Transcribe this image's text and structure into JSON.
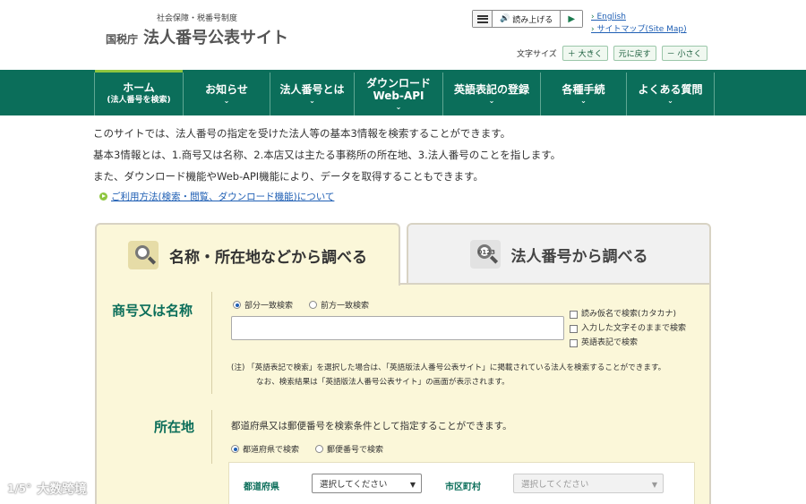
{
  "header": {
    "logo_sub": "社会保障・税番号制度",
    "logo_agency": "国税庁",
    "logo_title": "法人番号公表サイト",
    "read_aloud_label": "読み上げる",
    "play_symbol": "▶",
    "link_english": "English",
    "link_sitemap": "サイトマップ(Site Map)",
    "fontsize_label": "文字サイズ",
    "font_larger": "＋ 大きく",
    "font_reset": "元に戻す",
    "font_smaller": "－ 小さく"
  },
  "nav": {
    "items": [
      {
        "label": "ホーム",
        "sub": "(法人番号を検索)"
      },
      {
        "label": "お知らせ"
      },
      {
        "label": "法人番号とは"
      },
      {
        "label": "ダウンロード",
        "sub": "Web-API"
      },
      {
        "label": "英語表記の登録"
      },
      {
        "label": "各種手続"
      },
      {
        "label": "よくある質問"
      }
    ],
    "chev": "⌄"
  },
  "intro": {
    "line1": "このサイトでは、法人番号の指定を受けた法人等の基本3情報を検索することができます。",
    "line2": "基本3情報とは、1.商号又は名称、2.本店又は主たる事務所の所在地、3.法人番号のことを指します。",
    "line3": "また、ダウンロード機能やWeb-API機能により、データを取得することもできます。",
    "help_link": "ご利用方法(検索・閲覧、ダウンロード機能)について"
  },
  "tabs": {
    "name_search": "名称・所在地などから調べる",
    "number_search": "法人番号から調べる",
    "number_icon_text": "0123"
  },
  "form": {
    "name_label": "商号又は名称",
    "radio_partial": "部分一致検索",
    "radio_prefix": "前方一致検索",
    "check_kana": "読み仮名で検索(カタカナ)",
    "check_exact": "入力した文字そのままで検索",
    "check_english": "英語表記で検索",
    "note_line1": "(注) 「英語表記で検索」を選択した場合は、「英語版法人番号公表サイト」に掲載されている法人を検索することができます。",
    "note_line2": "なお、検索結果は「英語版法人番号公表サイト」の画面が表示されます。",
    "loc_label": "所在地",
    "loc_desc": "都道府県又は郵便番号を検索条件として指定することができます。",
    "radio_pref": "都道府県で検索",
    "radio_postal": "郵便番号で検索",
    "pref_label": "都道府県",
    "pref_select": "選択してください",
    "city_label": "市区町村",
    "city_select": "選択してください"
  },
  "watermark": {
    "logo": "1/5°",
    "text": "大数跨境"
  }
}
